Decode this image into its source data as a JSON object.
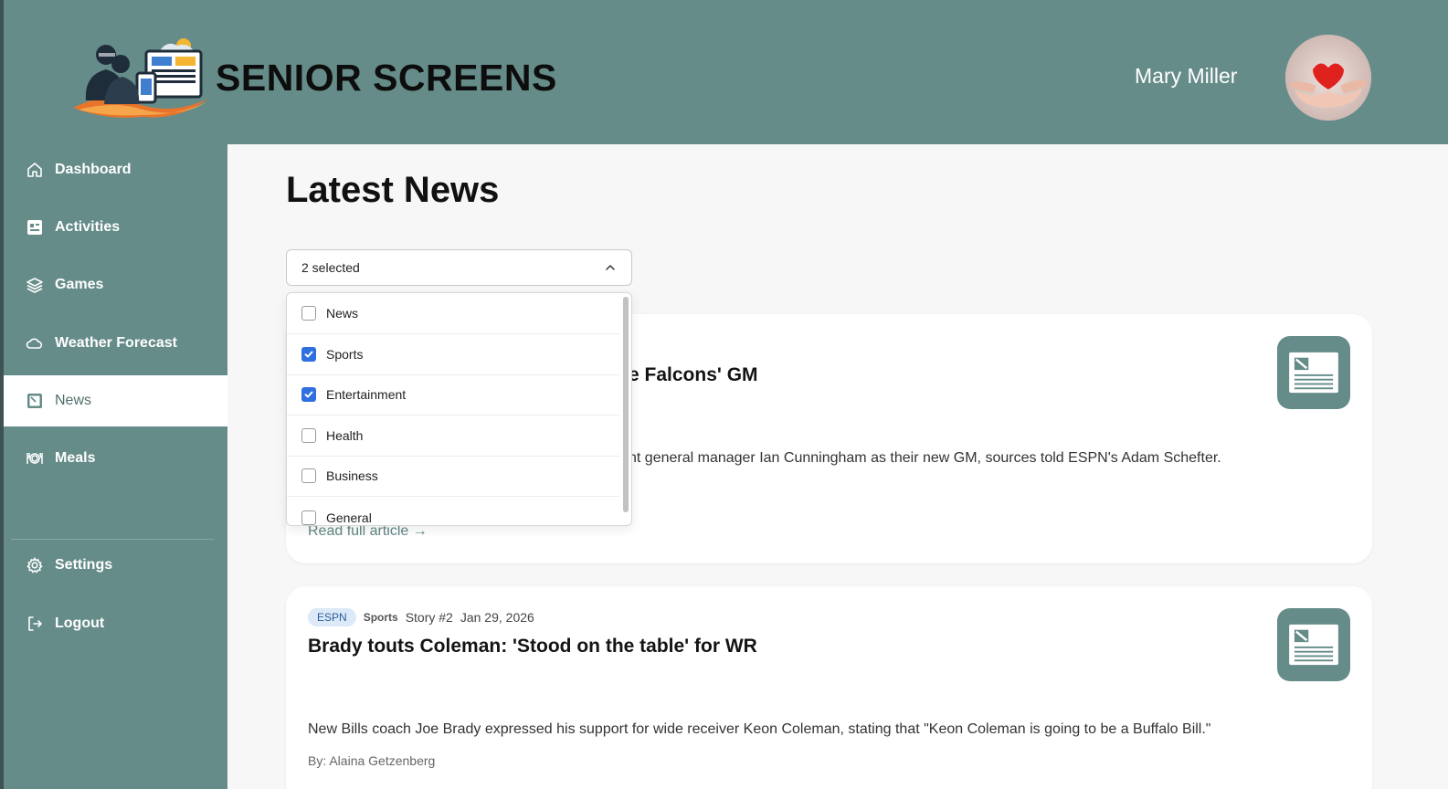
{
  "app": {
    "title": "SENIOR SCREENS",
    "user_name": "Mary Miller"
  },
  "sidebar": {
    "items": [
      {
        "label": "Dashboard",
        "icon": "home-icon"
      },
      {
        "label": "Activities",
        "icon": "calendar-icon"
      },
      {
        "label": "Games",
        "icon": "layers-icon"
      },
      {
        "label": "Weather Forecast",
        "icon": "cloud-icon"
      },
      {
        "label": "News",
        "icon": "newspaper-icon",
        "active": true
      },
      {
        "label": "Meals",
        "icon": "plate-icon"
      }
    ],
    "settings_label": "Settings",
    "logout_label": "Logout"
  },
  "main": {
    "page_title": "Latest News",
    "filter": {
      "selected_text": "2 selected",
      "options": [
        {
          "label": "News",
          "checked": false
        },
        {
          "label": "Sports",
          "checked": true
        },
        {
          "label": "Entertainment",
          "checked": true
        },
        {
          "label": "Health",
          "checked": false
        },
        {
          "label": "Business",
          "checked": false
        },
        {
          "label": "General",
          "checked": false
        }
      ]
    },
    "articles": [
      {
        "title_visible": "e Falcons' GM",
        "description_visible": "nt general manager Ian Cunningham as their new GM, sources told ESPN's Adam Schefter.",
        "read_link": "Read full article →"
      },
      {
        "source": "ESPN",
        "category": "Sports",
        "story": "Story #2",
        "date": "Jan 29, 2026",
        "title": "Brady touts Coleman: 'Stood on the table' for WR",
        "description": "New Bills coach Joe Brady expressed his support for wide receiver Keon Coleman, stating that \"Keon Coleman is going to be a Buffalo Bill.\"",
        "byline": "By: Alaina Getzenberg"
      }
    ]
  },
  "colors": {
    "primary": "#658c89",
    "checkbox_checked": "#2f6fe0",
    "badge_bg": "#dbe9f8",
    "link": "#5f8784"
  }
}
